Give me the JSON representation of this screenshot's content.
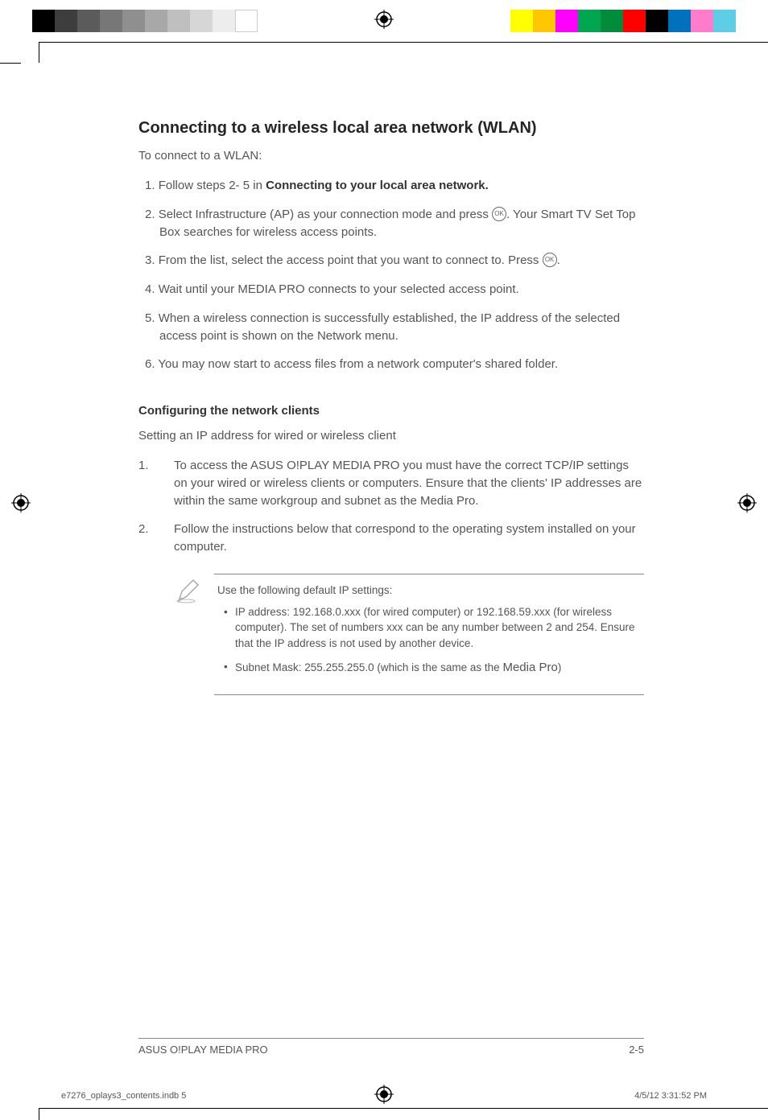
{
  "section": {
    "title": "Connecting to a wireless local area network (WLAN)",
    "intro": "To connect to a WLAN:",
    "steps": [
      {
        "num": "1.",
        "pre": "Follow steps 2- 5 in ",
        "bold": "Connecting to your local area network."
      },
      {
        "num": "2.",
        "pre": "Select Infrastructure (AP) as your connection mode and press ",
        "ok": true,
        "post": ". Your Smart TV Set Top Box searches for wireless access points."
      },
      {
        "num": "3.",
        "pre": "From the list, select the access point that you want to connect to. Press ",
        "ok": true,
        "post": "."
      },
      {
        "num": "4.",
        "pre": "Wait until your MEDIA PRO connects to your selected access point."
      },
      {
        "num": "5.",
        "pre": "When a wireless connection is successfully established, the IP address of the selected access point is shown on the Network menu."
      },
      {
        "num": "6.",
        "pre": "You may now start to access files from a network computer's shared folder."
      }
    ]
  },
  "subsection": {
    "heading": "Configuring the network clients",
    "intro": "Setting an IP address for wired or wireless client",
    "items": [
      {
        "num": "1.",
        "body": "To access the ASUS O!PLAY MEDIA PRO you must have the correct TCP/IP settings on your wired or wireless clients or computers. Ensure that the clients' IP addresses are within the same workgroup and subnet as the Media Pro."
      },
      {
        "num": "2.",
        "body": "Follow the instructions below that correspond to the operating system installed on your computer."
      }
    ]
  },
  "note": {
    "lead": "Use the following default IP settings:",
    "bullets": [
      {
        "text": "IP address: 192.168.0.xxx (for wired computer) or 192.168.59.xxx (for wireless computer).  The set of numbers xxx can be any number between 2 and 254. Ensure that the IP address is not used by another device."
      },
      {
        "text_pre": "Subnet Mask: 255.255.255.0 (which is the same as the ",
        "mp": "Media Pro",
        "text_post": ")"
      }
    ]
  },
  "footer": {
    "left": "ASUS O!PLAY MEDIA PRO",
    "right": "2-5"
  },
  "printfooter": {
    "left": "e7276_oplays3_contents.indb   5",
    "right": "4/5/12   3:31:52 PM"
  },
  "ok_label": "OK"
}
